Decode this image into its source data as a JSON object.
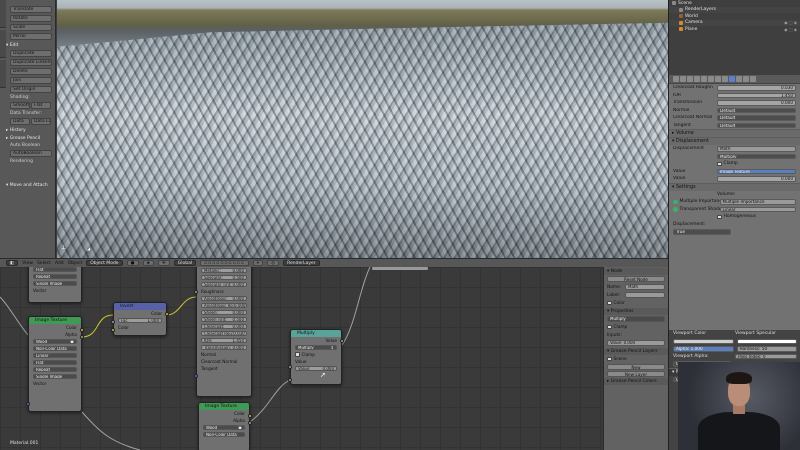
{
  "toolshelf": {
    "transform_buttons": [
      "Translate",
      "Rotate",
      "Scale",
      "Mirror"
    ],
    "edit_header": "Edit",
    "edit_buttons": [
      "Duplicate",
      "Duplicate Linked",
      "Delete",
      "Join"
    ],
    "set_origin": "Set Origin",
    "shading_label": "Shading:",
    "shading_smooth": "Smooth",
    "shading_flat": "Flat",
    "data_transfer_label": "Data Transfer:",
    "data_btn": "Data",
    "data_layout_btn": "Data La",
    "history_header": "History",
    "grease_pencil_header": "Grease Pencil",
    "auto_boolean": "Auto Boolean",
    "auto_boolean_2": "AutoBoolean",
    "rendering": "Rendering",
    "footer": "Move and Attach"
  },
  "outliner": {
    "rows": [
      {
        "label": "Scene",
        "icon_color": "#8a8a8a"
      },
      {
        "label": "RenderLayers",
        "icon_color": "#8a8a8a"
      },
      {
        "label": "World",
        "icon_color": "#9a5b3a"
      },
      {
        "label": "Camera",
        "icon_color": "#d48a2c"
      },
      {
        "label": "Plane",
        "icon_color": "#d48a2c"
      }
    ]
  },
  "properties": {
    "rows_top": [
      {
        "label": "Clearcoat Roughn",
        "value": "0.030",
        "kind": "num"
      },
      {
        "label": "IOR",
        "value": "1.450",
        "kind": "num"
      },
      {
        "label": "Transmission",
        "value": "0.000",
        "kind": "num"
      },
      {
        "label": "Normal",
        "value": "Default",
        "kind": "dark"
      },
      {
        "label": "Clearcoat Normal",
        "value": "Default",
        "kind": "dark"
      },
      {
        "label": "Tangent",
        "value": "Default",
        "kind": "dark"
      }
    ],
    "volume_header": "Volume",
    "displacement_header": "Displacement",
    "displacement_value": "Math",
    "multiply": "Multiply",
    "clamp": "Clamp",
    "value_label": "Value",
    "image_texture": "Image Texture",
    "value2": "0.000",
    "settings_header": "Settings",
    "volume_label": "Volume:",
    "multiple_importance": "Multiple Importance",
    "transparent_shadows": "Transparent Shadows",
    "homogeneous": "Homogeneous",
    "linear": "Linear",
    "displacement_label": "Displacement:",
    "true_value": "True",
    "viewport_color": "Viewport Color",
    "viewport_specular": "Viewport Specular",
    "alpha": "Alpha: 1.000",
    "hardness": "Hardness: 50",
    "viewport_alpha": "Viewport Alpha:",
    "pass_index": "Pass Index: 0",
    "opaque": "Opaque",
    "material_library": "Material Library VX",
    "cycles_templates": "Cycles Templates"
  },
  "node_header": {
    "menus": [
      "View",
      "Select",
      "Add",
      "Object"
    ],
    "mode": "Object Mode",
    "global": "Global",
    "render_layer": "RenderLayer"
  },
  "nodes": {
    "image_texture_1": {
      "title": "Image Texture",
      "color_label": "Color",
      "alpha_label": "Alpha",
      "file": "Wood",
      "color_space": "Non-Color Data",
      "interp": "Linear",
      "proj": "Flat",
      "ext": "Repeat",
      "src": "Single Image",
      "vector": "Vector"
    },
    "top_left": {
      "proj": "Flat",
      "ext": "Repeat",
      "src": "Single Image",
      "vector": "Vector"
    },
    "invert": {
      "title": "Invert",
      "color_out": "Color",
      "fac": "Fac",
      "fac_value": "1.000",
      "color_in": "Color"
    },
    "bsdf": {
      "rows": [
        {
          "label": "Metallic:",
          "value": "0.000"
        },
        {
          "label": "Specular:",
          "value": "0.500"
        },
        {
          "label": "Specular Tint:",
          "value": "0.000"
        },
        {
          "label": "Roughness",
          "value": ""
        },
        {
          "label": "Anisotropic:",
          "value": "0.000"
        },
        {
          "label": "Anisotropic Ro:",
          "value": "0.000"
        },
        {
          "label": "Sheen:",
          "value": "0.000"
        },
        {
          "label": "Sheen Tint:",
          "value": "0.500"
        },
        {
          "label": "Clearcoat:",
          "value": "0.000"
        },
        {
          "label": "Clearcoat Rou:",
          "value": "0.030"
        },
        {
          "label": "IOR:",
          "value": "1.450"
        },
        {
          "label": "Transmission:",
          "value": "0.000"
        },
        {
          "label": "Normal",
          "value": ""
        },
        {
          "label": "Clearcoat Normal",
          "value": ""
        },
        {
          "label": "Tangent",
          "value": ""
        }
      ]
    },
    "multiply": {
      "title": "Multiply",
      "value_out": "Value",
      "operation": "Multiply",
      "clamp": "Clamp",
      "value_in": "Value",
      "value_field_label": "Value:",
      "value_field": "0.000"
    },
    "image_texture_2": {
      "title": "Image Texture",
      "color_label": "Color",
      "alpha_label": "Alpha",
      "file": "Wood",
      "color_space": "Non-Color Data"
    },
    "status": "Material.001"
  },
  "node_npanel": {
    "node_header": "Node",
    "reset_node": "Reset Node",
    "name_label": "Name:",
    "name_value": "Math",
    "label_label": "Label:",
    "label_value": "",
    "color_header": "Color",
    "properties_header": "Properties",
    "operation": "Multiply",
    "clamp": "Clamp",
    "inputs_label": "Inputs:",
    "value_field": "Value: 0.000",
    "grease_pencil_layers": "Grease Pencil Layers",
    "scene_btn": "Scene",
    "new_btn": "New",
    "new_layer_btn": "New Layer",
    "grease_pencil_colors": "Grease Pencil Colors"
  },
  "colors": {
    "node_header_green": "#3f9a55",
    "node_header_blue": "#5661a8",
    "node_header_teal": "#5aa39a"
  }
}
